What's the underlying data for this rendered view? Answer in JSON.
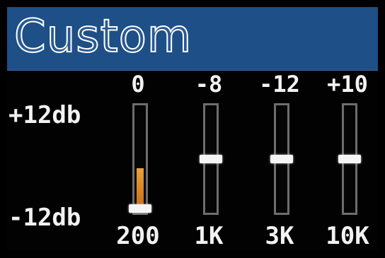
{
  "header": {
    "title": "Custom"
  },
  "scale": {
    "max_label": "+12db",
    "min_label": "-12db",
    "max": 12,
    "min": -12
  },
  "bands": [
    {
      "freq": "200",
      "value_label": "0",
      "slider_level": -11,
      "fill_level": -2
    },
    {
      "freq": "1K",
      "value_label": "-8",
      "slider_level": 0
    },
    {
      "freq": "3K",
      "value_label": "-12",
      "slider_level": 0
    },
    {
      "freq": "10K",
      "value_label": "+10",
      "slider_level": 0
    }
  ],
  "colors": {
    "header_bg": "#1e4f86",
    "fill": "#e09030",
    "knob": "#f5f5f5"
  }
}
